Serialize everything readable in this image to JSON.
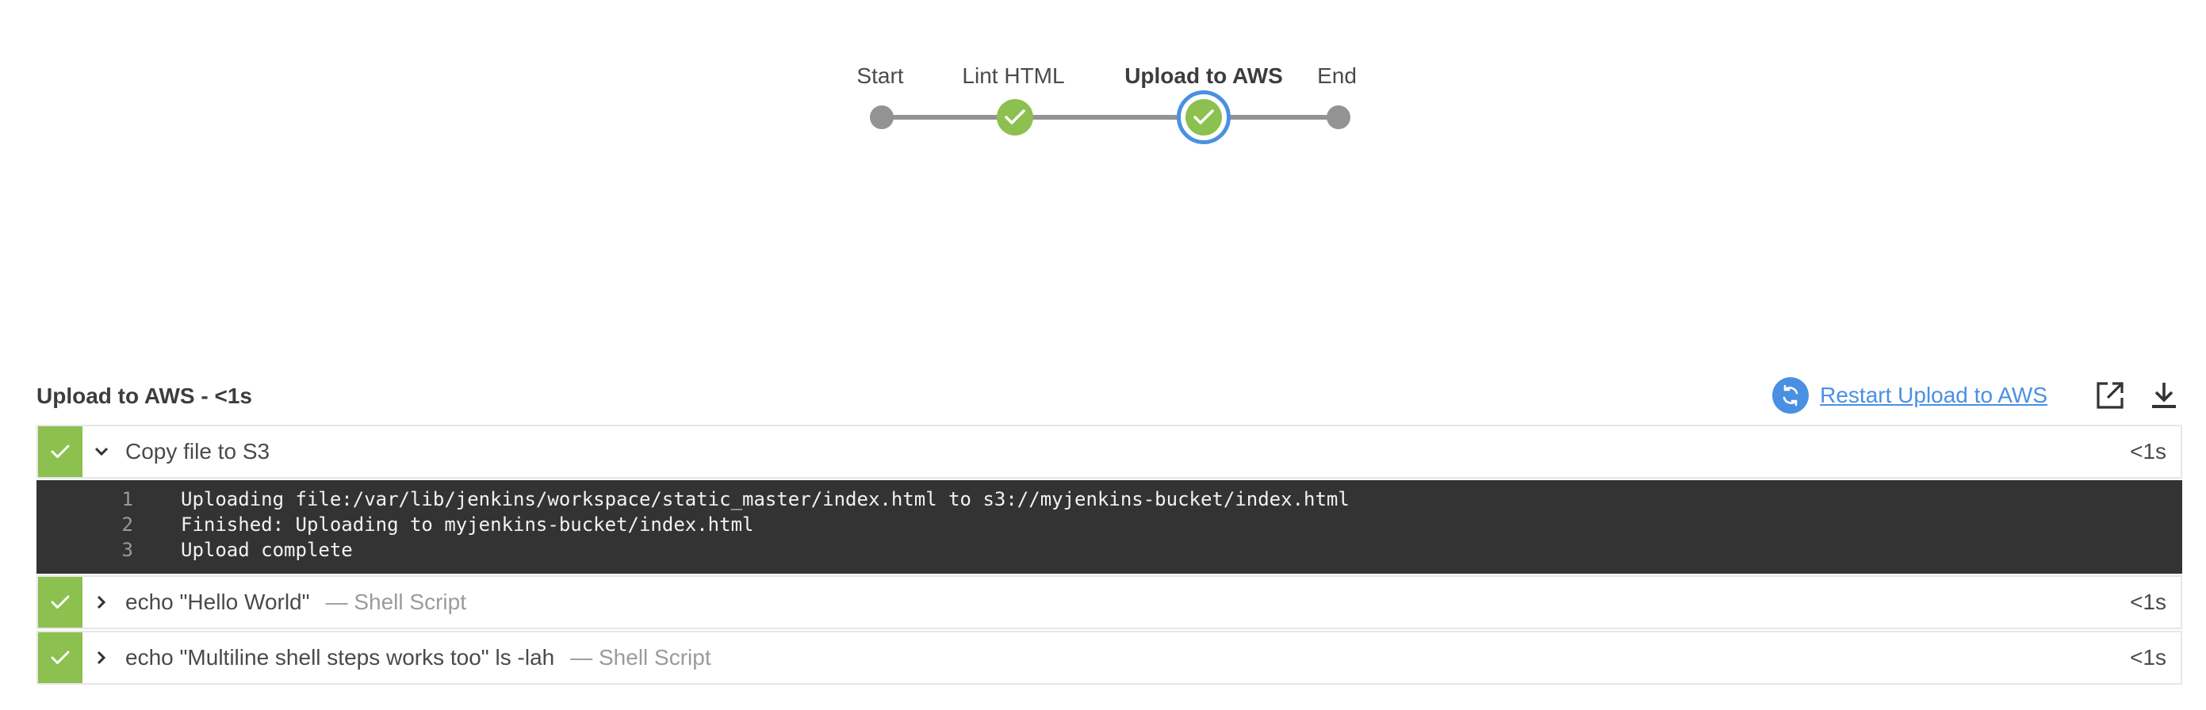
{
  "pipeline": {
    "stages": [
      {
        "label": "Start",
        "state": "none"
      },
      {
        "label": "Lint HTML",
        "state": "success"
      },
      {
        "label": "Upload to AWS",
        "state": "success-selected"
      },
      {
        "label": "End",
        "state": "none"
      }
    ]
  },
  "panel": {
    "title": "Upload to AWS - <1s",
    "restart_label": "Restart Upload to AWS",
    "icons": [
      "restart-icon",
      "open-external-icon",
      "download-icon"
    ]
  },
  "steps": [
    {
      "name": "Copy file to S3",
      "type": "",
      "duration": "<1s",
      "expanded": true,
      "status": "success"
    },
    {
      "name": "echo \"Hello World\"",
      "type": "— Shell Script",
      "duration": "<1s",
      "expanded": false,
      "status": "success"
    },
    {
      "name": "echo \"Multiline shell steps works too\" ls -lah",
      "type": "— Shell Script",
      "duration": "<1s",
      "expanded": false,
      "status": "success"
    }
  ],
  "log": [
    {
      "num": "1",
      "text": "Uploading file:/var/lib/jenkins/workspace/static_master/index.html to s3://myjenkins-bucket/index.html"
    },
    {
      "num": "2",
      "text": "Finished: Uploading to myjenkins-bucket/index.html"
    },
    {
      "num": "3",
      "text": "Upload complete"
    }
  ],
  "colors": {
    "success": "#8cc04f",
    "accent": "#4a90e2",
    "log_bg": "#333333",
    "track": "#949393"
  }
}
